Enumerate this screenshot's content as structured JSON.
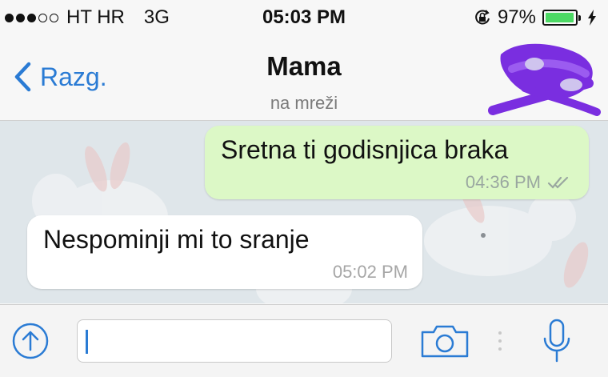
{
  "status_bar": {
    "carrier": "HT HR",
    "network": "3G",
    "time": "05:03 PM",
    "battery": "97%",
    "battery_level": 0.97,
    "signal_bars": 3,
    "signal_total": 5,
    "icons": [
      "rotation-lock-icon",
      "battery-icon",
      "charging-bolt-icon"
    ]
  },
  "header": {
    "back_label": "Razg.",
    "contact_name": "Mama",
    "contact_status": "na mreži"
  },
  "messages": [
    {
      "direction": "outgoing",
      "text": "Sretna ti godisnjica braka",
      "time": "04:36 PM",
      "read_icon": "double-check-icon"
    },
    {
      "direction": "incoming",
      "text": "Nespominji mi to sranje",
      "time": "05:02 PM"
    }
  ],
  "composer": {
    "input_value": "",
    "icons": [
      "upload-icon",
      "camera-icon",
      "microphone-icon"
    ]
  },
  "colors": {
    "accent": "#2a7bd4",
    "outgoing_bubble": "#dcf8c6",
    "incoming_bubble": "#ffffff",
    "chat_background": "#dfe6ea",
    "avatar_scribble": "#7a2ee0"
  }
}
